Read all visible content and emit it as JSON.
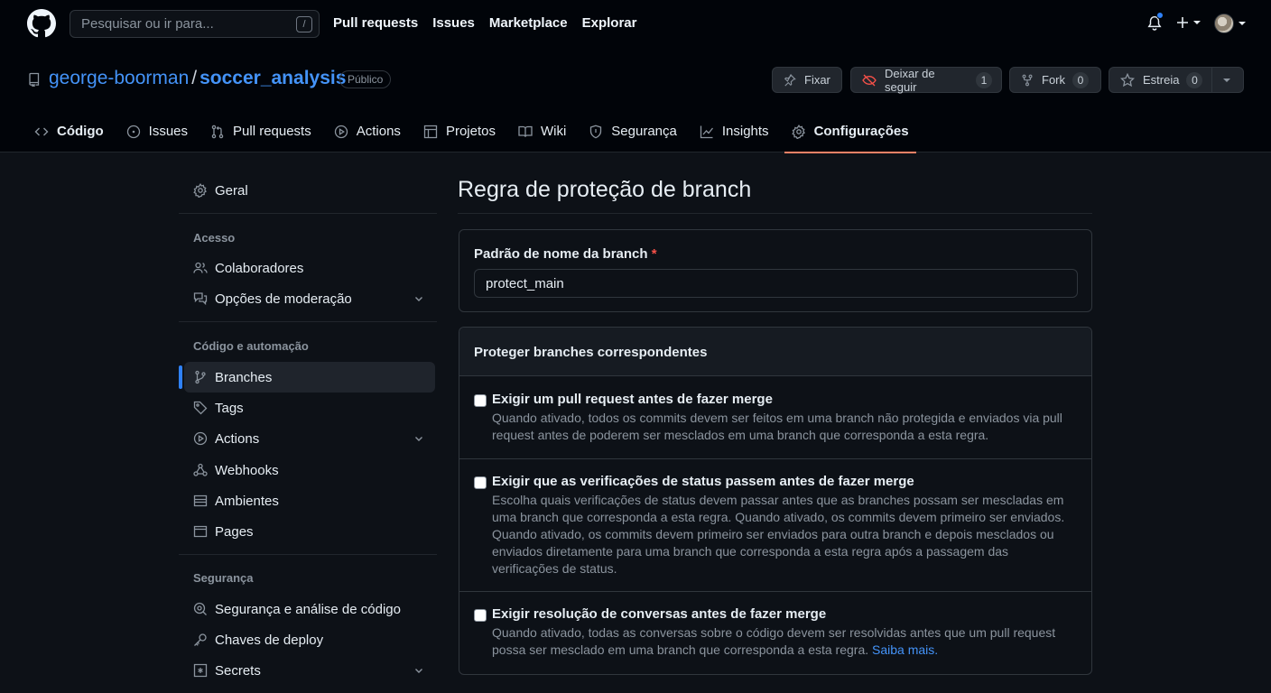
{
  "header": {
    "search_placeholder": "Pesquisar ou ir para...",
    "search_shortcut": "/",
    "nav": [
      "Pull requests",
      "Issues",
      "Marketplace",
      "Explorar"
    ]
  },
  "repo": {
    "owner": "george-boorman",
    "separator": "/",
    "name": "soccer_analysis",
    "visibility": "Público",
    "pin_label": "Fixar",
    "unwatch_label": "Deixar de seguir",
    "watch_count": "1",
    "fork_label": "Fork",
    "fork_count": "0",
    "star_label": "Estreia",
    "star_count": "0"
  },
  "tabs": [
    {
      "label": "Código",
      "icon": "code-icon",
      "active": false
    },
    {
      "label": "Issues",
      "icon": "issue-icon"
    },
    {
      "label": "Pull requests",
      "icon": "pull-request-icon"
    },
    {
      "label": "Actions",
      "icon": "play-icon"
    },
    {
      "label": "Projetos",
      "icon": "table-icon"
    },
    {
      "label": "Wiki",
      "icon": "book-icon"
    },
    {
      "label": "Segurança",
      "icon": "shield-icon"
    },
    {
      "label": "Insights",
      "icon": "graph-icon"
    },
    {
      "label": "Configurações",
      "icon": "gear-icon",
      "active": true
    }
  ],
  "sidebar": {
    "general": "Geral",
    "access_heading": "Acesso",
    "collaborators": "Colaboradores",
    "moderation": "Opções de moderação",
    "code_heading": "Código e automação",
    "branches": "Branches",
    "tags": "Tags",
    "actions": "Actions",
    "webhooks": "Webhooks",
    "environments": "Ambientes",
    "pages": "Pages",
    "security_heading": "Segurança",
    "code_security": "Segurança e análise de código",
    "deploy_keys": "Chaves de deploy",
    "secrets": "Secrets"
  },
  "main": {
    "title": "Regra de proteção de branch",
    "pattern_label": "Padrão de nome da branch",
    "required_mark": "*",
    "pattern_value": "protect_main",
    "protect_heading": "Proteger branches correspondentes",
    "options": [
      {
        "title": "Exigir um pull request antes de fazer merge",
        "desc": "Quando ativado, todos os commits devem ser feitos em uma branch não protegida e enviados via pull request antes de poderem ser mesclados em uma branch que corresponda a esta regra.",
        "checked": false
      },
      {
        "title": "Exigir que as verificações de status passem antes de fazer merge",
        "desc": "Escolha quais verificações de status devem passar antes que as branches possam ser mescladas em uma branch que corresponda a esta regra. Quando ativado, os commits devem primeiro ser enviados. Quando ativado, os commits devem primeiro ser enviados para outra branch e depois mesclados ou enviados diretamente para uma branch que corresponda a esta regra após a passagem das verificações de status.",
        "checked": false
      },
      {
        "title": "Exigir resolução de conversas antes de fazer merge",
        "desc": "Quando ativado, todas as conversas sobre o código devem ser resolvidas antes que um pull request possa ser mesclado em uma branch que corresponda a esta regra.",
        "link": "Saiba mais.",
        "checked": false
      }
    ]
  },
  "colors": {
    "background": "#0d1117",
    "header": "#010409",
    "accent": "#2f81f7",
    "active_tab_underline": "#f78166",
    "link": "#4493f8",
    "required": "#f85149"
  }
}
